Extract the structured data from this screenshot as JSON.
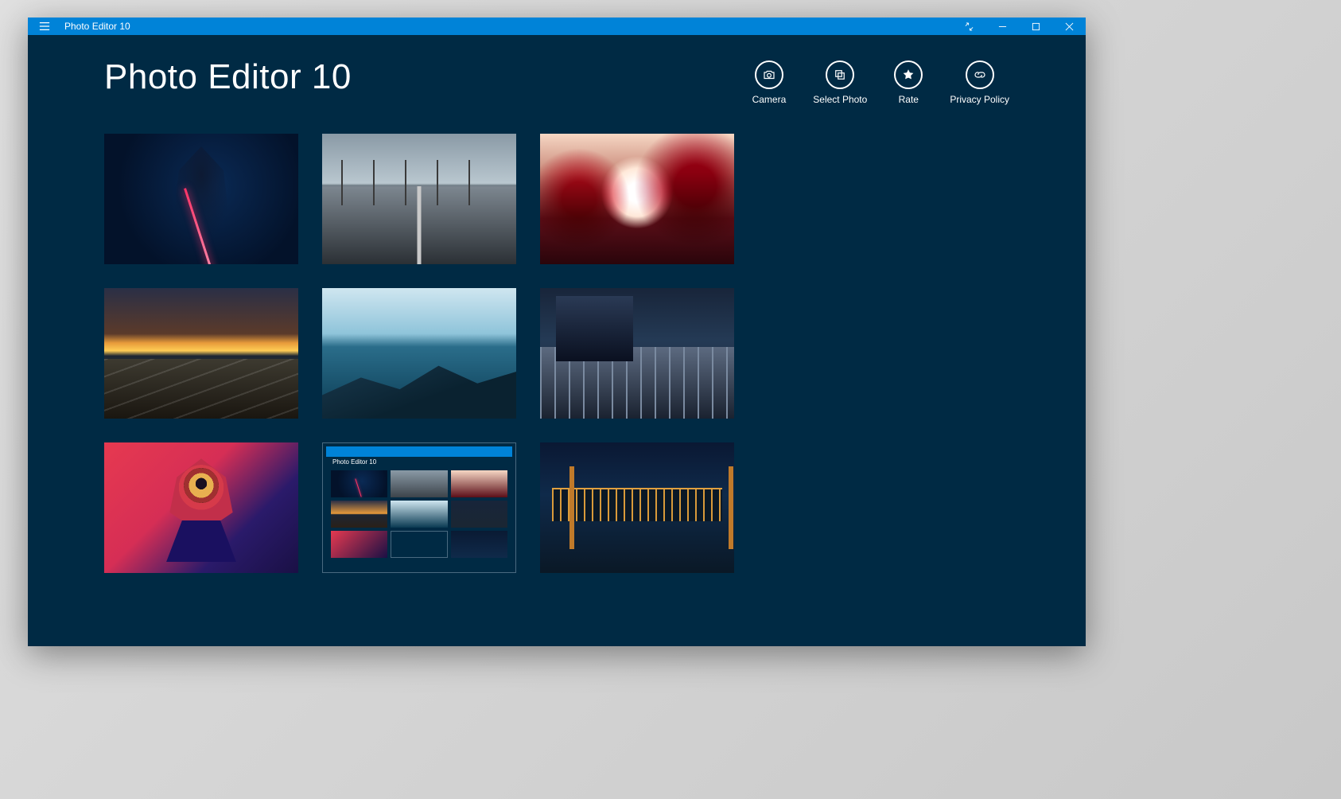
{
  "titlebar": {
    "app_title": "Photo Editor 10"
  },
  "page": {
    "title": "Photo Editor 10"
  },
  "actions": {
    "camera": {
      "label": "Camera",
      "icon": "camera-icon"
    },
    "select": {
      "label": "Select Photo",
      "icon": "copy-icon"
    },
    "rate": {
      "label": "Rate",
      "icon": "star-icon"
    },
    "privacy": {
      "label": "Privacy Policy",
      "icon": "link-icon"
    }
  },
  "mini": {
    "title": "Photo Editor 10"
  }
}
